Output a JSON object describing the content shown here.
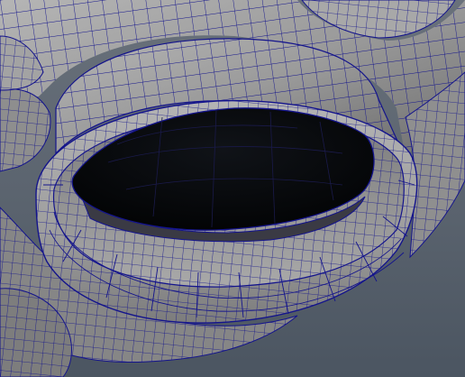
{
  "viewport": {
    "background_top": "#69717b",
    "background_bottom": "#4e5863",
    "wireframe_color": "#14148c",
    "mesh_shading": "#9c9c9c",
    "cavity_color": "#050607"
  }
}
